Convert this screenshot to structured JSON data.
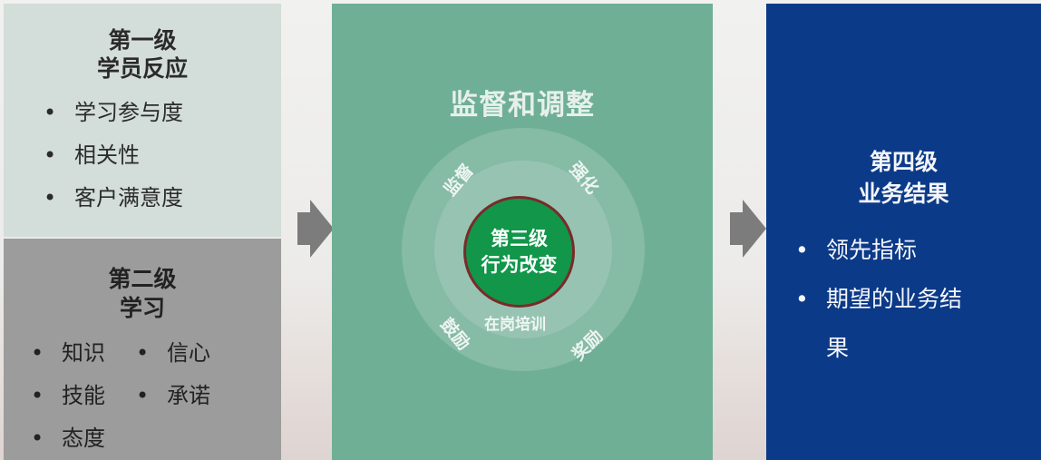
{
  "level1": {
    "title_line1": "第一级",
    "title_line2": "学员反应",
    "items": [
      "学习参与度",
      "相关性",
      "客户满意度"
    ]
  },
  "level2": {
    "title_line1": "第二级",
    "title_line2": "学习",
    "items_col1": [
      "知识",
      "技能",
      "态度"
    ],
    "items_col2": [
      "信心",
      "承诺"
    ]
  },
  "level3": {
    "section_title": "监督和调整",
    "core_line1": "第三级",
    "core_line2": "行为改变",
    "ring_labels": {
      "top_left": "监督",
      "top_right": "强化",
      "bottom_left": "鼓励",
      "bottom_right": "奖励",
      "bottom_center": "在岗培训"
    }
  },
  "level4": {
    "title_line1": "第四级",
    "title_line2": "业务结果",
    "items": [
      "领先指标",
      "期望的业务结",
      "果"
    ]
  },
  "colors": {
    "level1_bg": "#d3ddd9",
    "level2_bg": "#9c9c9c",
    "level3_bg": "#6faf96",
    "core_green": "#11964a",
    "level4_bg": "#0b3a88",
    "arrow": "#7c7c7c"
  }
}
